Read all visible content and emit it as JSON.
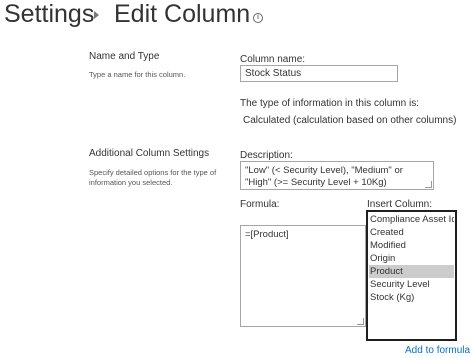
{
  "breadcrumb": {
    "root": "Settings",
    "page": "Edit Column",
    "info_icon": "info-icon"
  },
  "name_and_type": {
    "title": "Name and Type",
    "description": "Type a name for this column.",
    "column_name_label": "Column name:",
    "column_name_value": "Stock Status",
    "type_label": "The type of information in this column is:",
    "type_value": "Calculated (calculation based on other columns)"
  },
  "additional": {
    "title": "Additional Column Settings",
    "description": "Specify detailed options for the type of information you selected.",
    "description_label": "Description:",
    "description_value": "\"Low\" (< Security Level), \"Medium\" or \"High\" (>= Security Level + 10Kg)",
    "formula_label": "Formula:",
    "formula_value": "=[Product]",
    "insert_column_label": "Insert Column:",
    "columns": [
      "Compliance Asset Id",
      "Created",
      "Modified",
      "Origin",
      "Product",
      "Security Level",
      "Stock (Kg)"
    ],
    "selected_column": "Product",
    "add_to_formula": "Add to formula"
  }
}
